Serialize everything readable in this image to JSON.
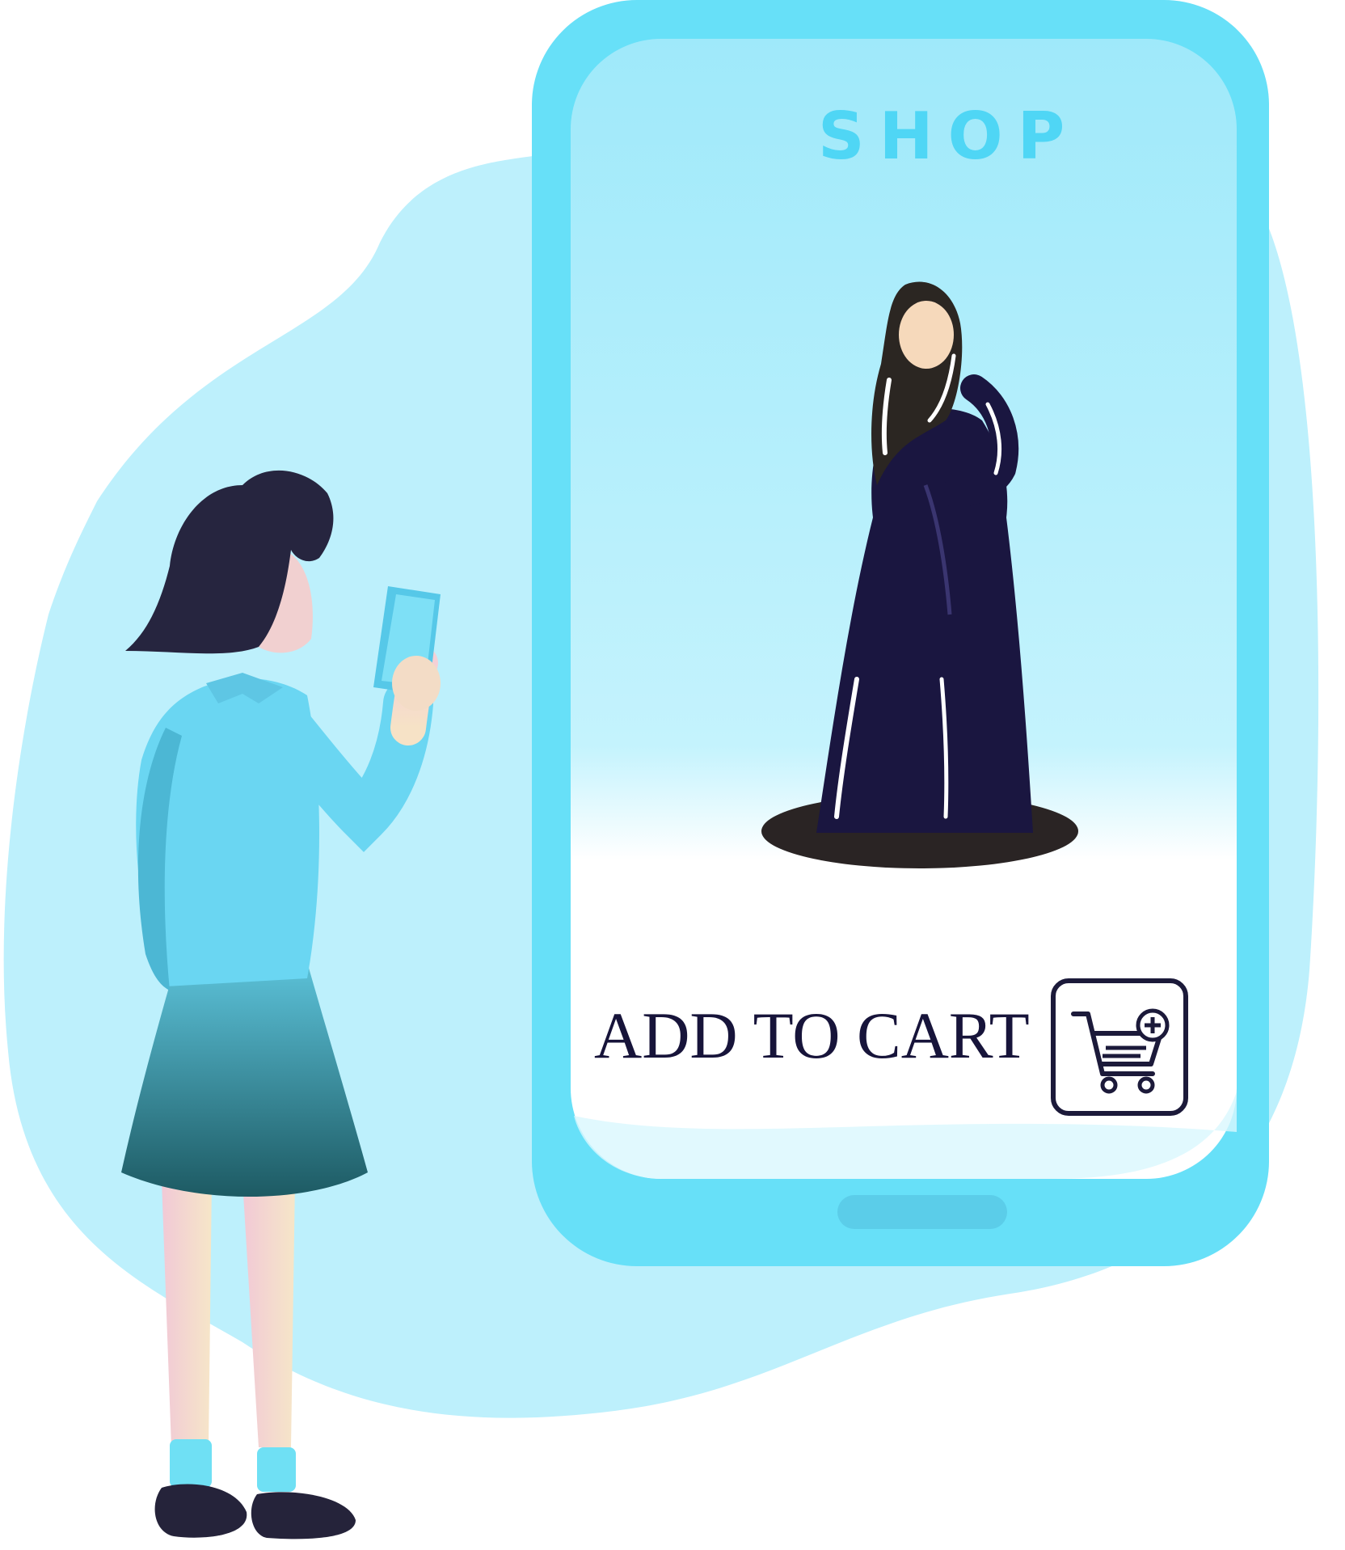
{
  "screen": {
    "shop_title": "SHOP",
    "add_to_cart_label": "ADD TO CART",
    "cart_button_icon": "cart-plus-icon"
  },
  "colors": {
    "blob": "#bdf0fc",
    "phone_frame": "#67e0f8",
    "screen_bg": "#a9ecfb",
    "text_dark": "#17143a",
    "dress": "#1a1640",
    "hijab": "#2b2622"
  }
}
